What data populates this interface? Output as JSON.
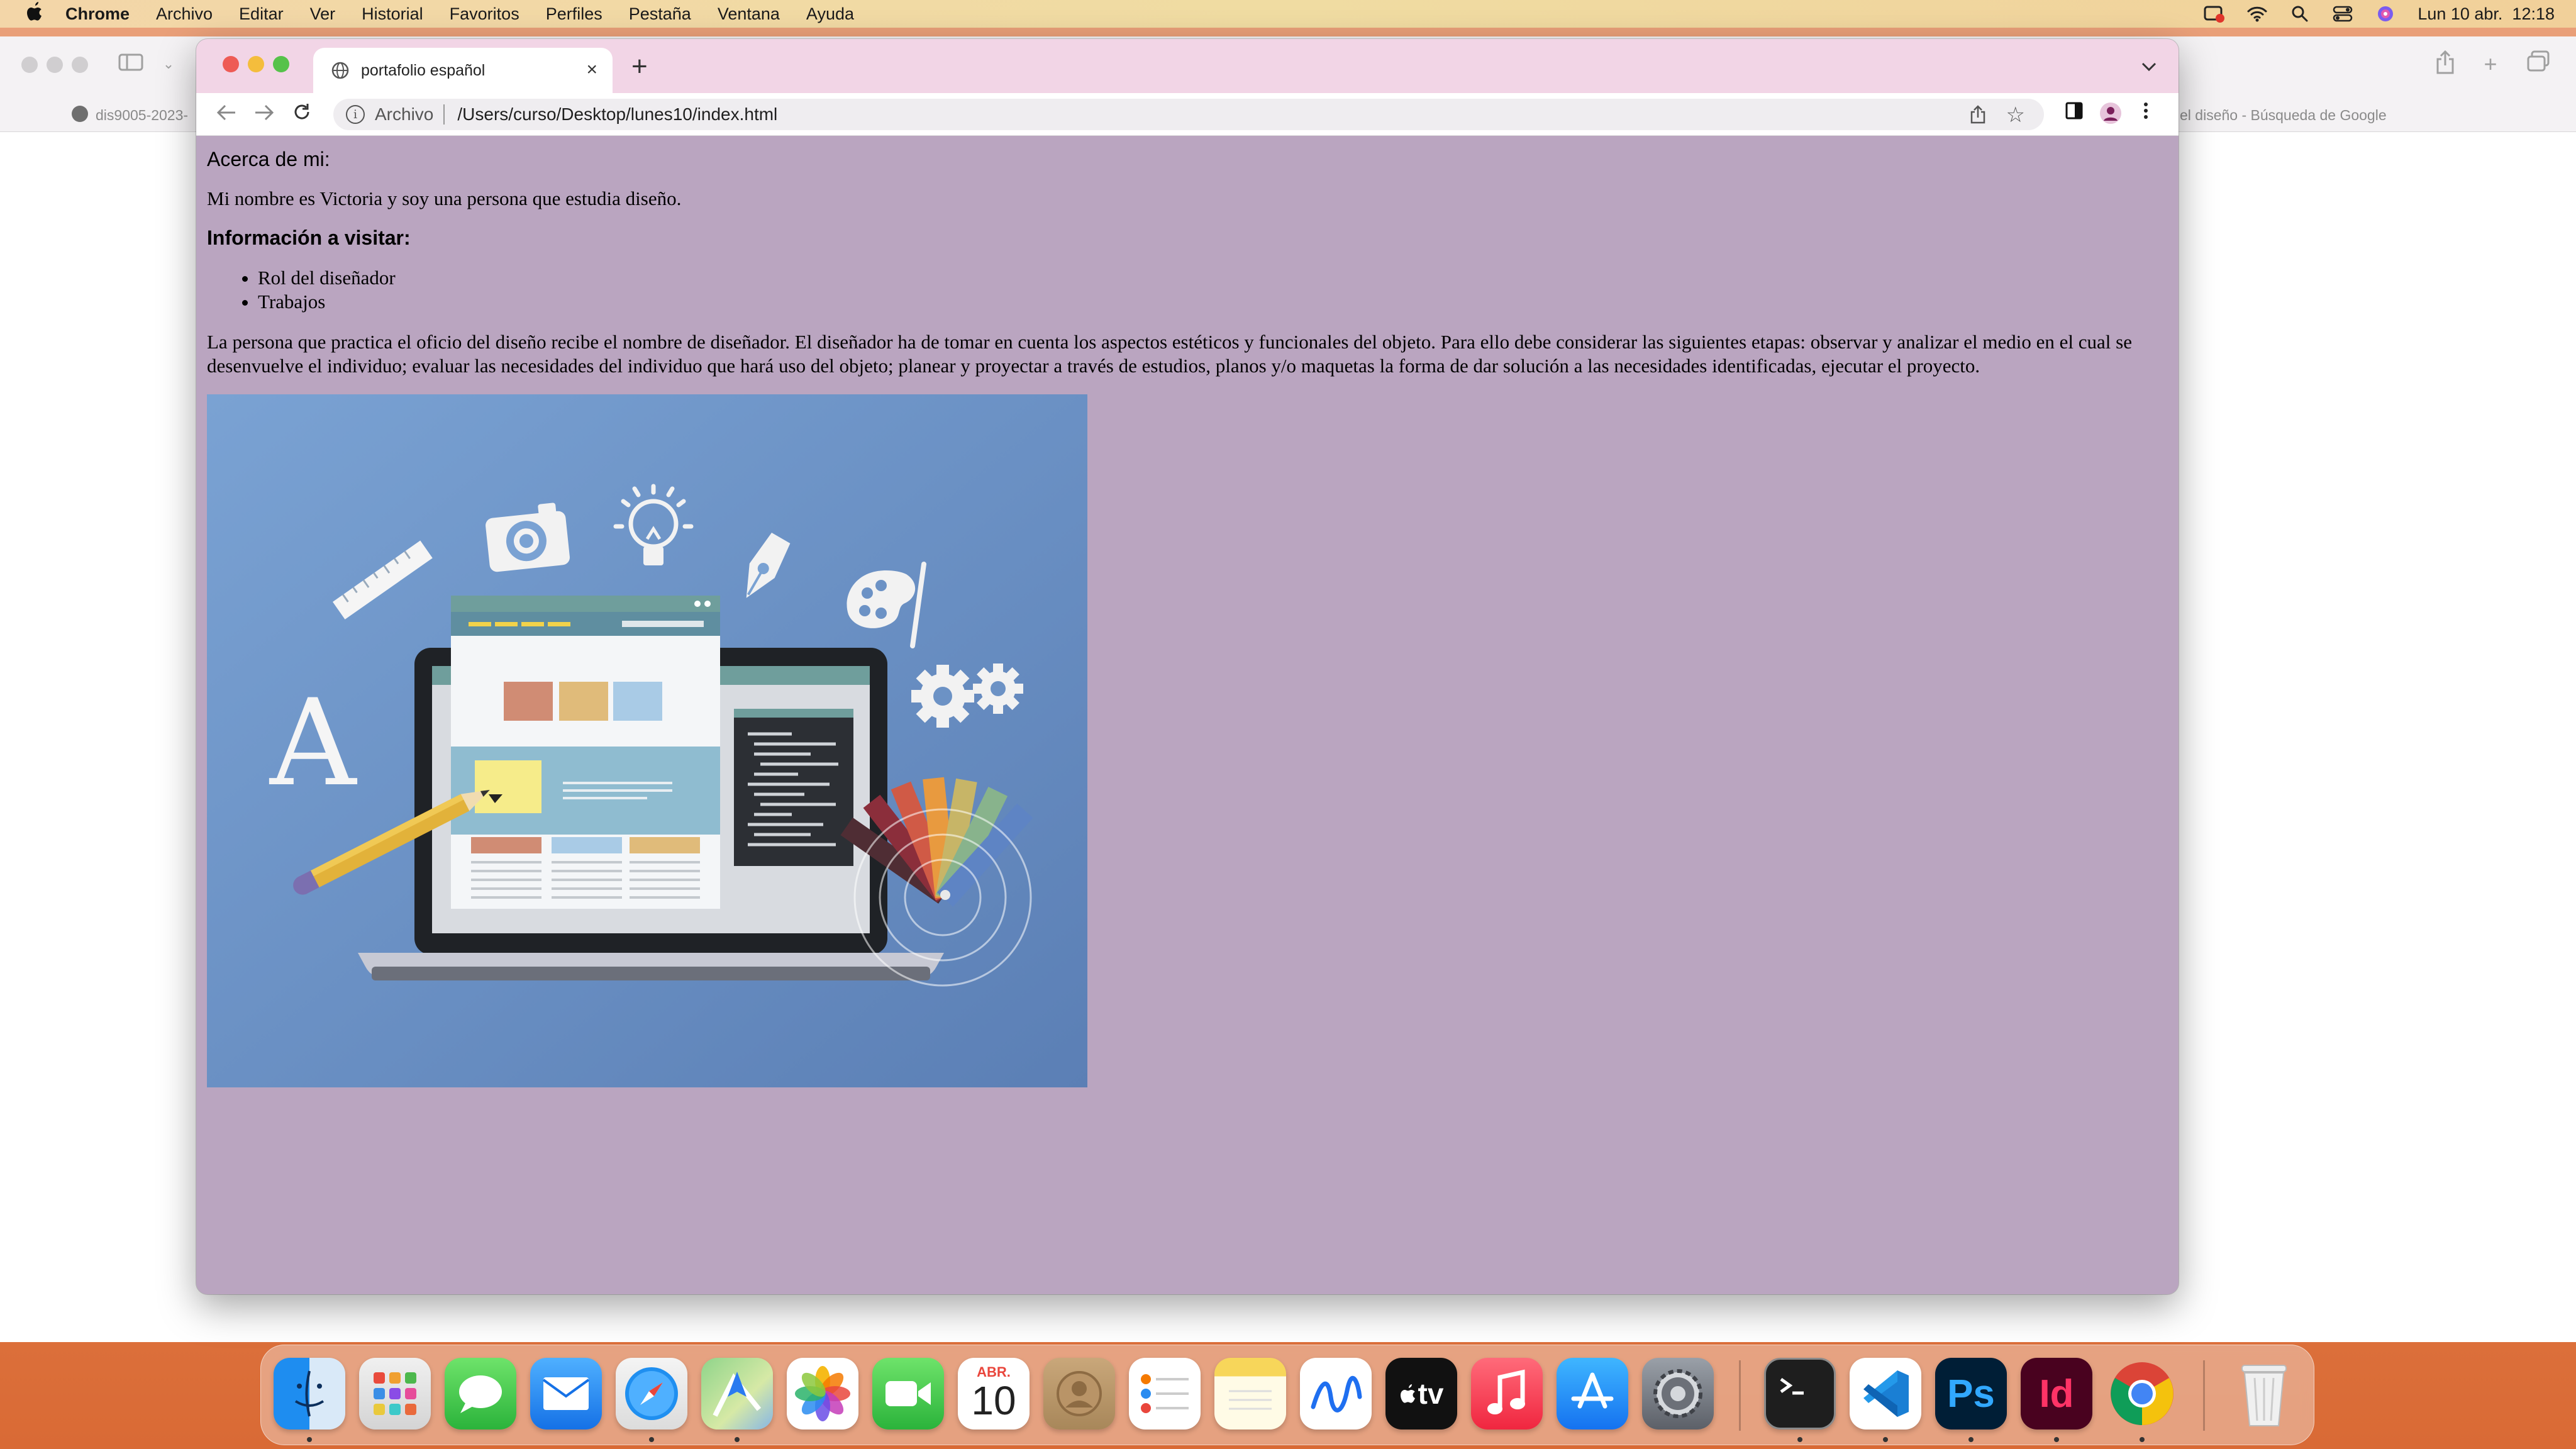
{
  "menubar": {
    "app_name": "Chrome",
    "items": [
      "Archivo",
      "Editar",
      "Ver",
      "Historial",
      "Favoritos",
      "Perfiles",
      "Pestaña",
      "Ventana",
      "Ayuda"
    ],
    "clock": "Lun 10 abr.  12:18",
    "icons": [
      "apple-icon",
      "screen-recording-icon",
      "wifi-icon",
      "spotlight-icon",
      "control-center-icon",
      "siri-icon"
    ]
  },
  "background_window": {
    "tab_left": "dis9005-2023-",
    "tab_right": "el diseño - Búsqueda de Google"
  },
  "browser": {
    "tab_title": "portafolio español",
    "new_tab": "+",
    "close": "×",
    "url_scheme": "Archivo",
    "url": "/Users/curso/Desktop/lunes10/index.html"
  },
  "page": {
    "about_heading": "Acerca de mi:",
    "intro": "Mi nombre es Victoria y soy una persona que estudia diseño.",
    "visit_heading": "Información a visitar:",
    "visit_items": [
      "Rol del diseñador",
      "Trabajos"
    ],
    "paragraph": "La persona que practica el oficio del diseño recibe el nombre de diseñador. El diseñador ha de tomar en cuenta los aspectos estéticos y funcionales del objeto. Para ello debe considerar las siguientes etapas: observar y analizar el medio en el cual se desenvuelve el individuo; evaluar las necesidades del individuo que hará uso del objeto; planear y proyectar a través de estudios, planos y/o maquetas la forma de dar solución a las necesidades identificadas, ejecutar el proyecto.",
    "illustration_letter": "A"
  },
  "dock": {
    "calendar_month": "ABR.",
    "calendar_day": "10",
    "apple_tv": "tv",
    "photoshop": "Ps",
    "indesign": "Id",
    "apps": [
      "Finder",
      "Launchpad",
      "Messages",
      "Mail",
      "Safari",
      "Maps",
      "Photos",
      "FaceTime",
      "Calendar",
      "Contacts",
      "Reminders",
      "Notes",
      "Freeform",
      "Apple TV",
      "Music",
      "App Store",
      "System Settings",
      "Terminal",
      "Visual Studio Code",
      "Photoshop",
      "InDesign",
      "Chrome",
      "Trash"
    ]
  },
  "colors": {
    "page_background": "#baa5c0",
    "tab_strip": "#f2d5e6",
    "illustration_background": "#6c92c5"
  }
}
